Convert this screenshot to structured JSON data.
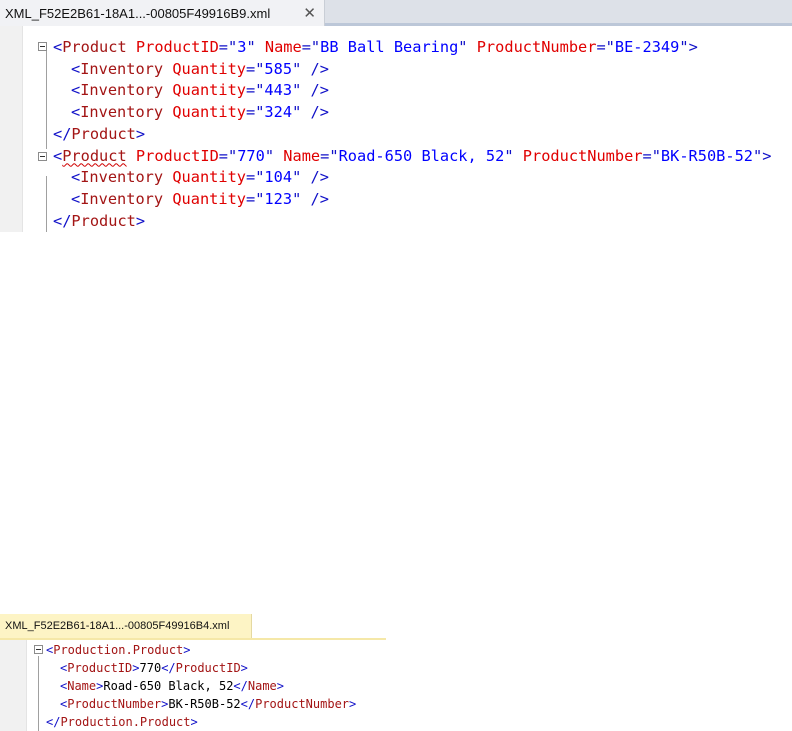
{
  "top_panel": {
    "tab_title": "XML_F52E2B61-18A1...-00805F49916B9.xml",
    "close_glyph": "✕",
    "lines": [
      {
        "indent": 0,
        "parts": [
          [
            "<",
            "br"
          ],
          [
            "Product",
            "el"
          ],
          [
            " ProductID",
            "at"
          ],
          [
            "=\"",
            "br"
          ],
          [
            "3",
            "va"
          ],
          [
            "\"",
            "br"
          ],
          [
            " Name",
            "at"
          ],
          [
            "=\"",
            "br"
          ],
          [
            "BB Ball Bearing",
            "va"
          ],
          [
            "\"",
            "br"
          ],
          [
            " ProductNumber",
            "at"
          ],
          [
            "=\"",
            "br"
          ],
          [
            "BE-2349",
            "va"
          ],
          [
            "\"",
            "br"
          ],
          [
            ">",
            "br"
          ]
        ]
      },
      {
        "indent": 1,
        "parts": [
          [
            "<",
            "br"
          ],
          [
            "Inventory",
            "el"
          ],
          [
            " Quantity",
            "at"
          ],
          [
            "=\"",
            "br"
          ],
          [
            "585",
            "va"
          ],
          [
            "\"",
            "br"
          ],
          [
            " />",
            "br"
          ]
        ]
      },
      {
        "indent": 1,
        "parts": [
          [
            "<",
            "br"
          ],
          [
            "Inventory",
            "el"
          ],
          [
            " Quantity",
            "at"
          ],
          [
            "=\"",
            "br"
          ],
          [
            "443",
            "va"
          ],
          [
            "\"",
            "br"
          ],
          [
            " />",
            "br"
          ]
        ]
      },
      {
        "indent": 1,
        "parts": [
          [
            "<",
            "br"
          ],
          [
            "Inventory",
            "el"
          ],
          [
            " Quantity",
            "at"
          ],
          [
            "=\"",
            "br"
          ],
          [
            "324",
            "va"
          ],
          [
            "\"",
            "br"
          ],
          [
            " />",
            "br"
          ]
        ]
      },
      {
        "indent": 0,
        "parts": [
          [
            "</",
            "br"
          ],
          [
            "Product",
            "el"
          ],
          [
            ">",
            "br"
          ]
        ]
      },
      {
        "indent": 0,
        "parts": [
          [
            "<",
            "br"
          ],
          [
            "Product",
            "el squiggle"
          ],
          [
            " ProductID",
            "at"
          ],
          [
            "=\"",
            "br"
          ],
          [
            "770",
            "va"
          ],
          [
            "\"",
            "br"
          ],
          [
            " Name",
            "at"
          ],
          [
            "=\"",
            "br"
          ],
          [
            "Road-650 Black, 52",
            "va"
          ],
          [
            "\"",
            "br"
          ],
          [
            " ProductNumber",
            "at"
          ],
          [
            "=\"",
            "br"
          ],
          [
            "BK-R50B-52",
            "va"
          ],
          [
            "\"",
            "br"
          ],
          [
            ">",
            "br"
          ]
        ]
      },
      {
        "indent": 1,
        "parts": [
          [
            "<",
            "br"
          ],
          [
            "Inventory",
            "el"
          ],
          [
            " Quantity",
            "at"
          ],
          [
            "=\"",
            "br"
          ],
          [
            "104",
            "va"
          ],
          [
            "\"",
            "br"
          ],
          [
            " />",
            "br"
          ]
        ]
      },
      {
        "indent": 1,
        "parts": [
          [
            "<",
            "br"
          ],
          [
            "Inventory",
            "el"
          ],
          [
            " Quantity",
            "at"
          ],
          [
            "=\"",
            "br"
          ],
          [
            "123",
            "va"
          ],
          [
            "\"",
            "br"
          ],
          [
            " />",
            "br"
          ]
        ]
      },
      {
        "indent": 0,
        "parts": [
          [
            "</",
            "br"
          ],
          [
            "Product",
            "el"
          ],
          [
            ">",
            "br"
          ]
        ]
      }
    ]
  },
  "bottom_panel": {
    "tab_title": "XML_F52E2B61-18A1...-00805F49916B4.xml",
    "lines": [
      {
        "indent": 0,
        "parts": [
          [
            "<",
            "br"
          ],
          [
            "Production.Product",
            "el"
          ],
          [
            ">",
            "br"
          ]
        ]
      },
      {
        "indent": 1,
        "parts": [
          [
            "<",
            "br"
          ],
          [
            "ProductID",
            "el"
          ],
          [
            ">",
            "br"
          ],
          [
            "770",
            "tx"
          ],
          [
            "</",
            "br"
          ],
          [
            "ProductID",
            "el"
          ],
          [
            ">",
            "br"
          ]
        ]
      },
      {
        "indent": 1,
        "parts": [
          [
            "<",
            "br"
          ],
          [
            "Name",
            "el"
          ],
          [
            ">",
            "br"
          ],
          [
            "Road-650 Black, 52",
            "tx"
          ],
          [
            "</",
            "br"
          ],
          [
            "Name",
            "el"
          ],
          [
            ">",
            "br"
          ]
        ]
      },
      {
        "indent": 1,
        "parts": [
          [
            "<",
            "br"
          ],
          [
            "ProductNumber",
            "el"
          ],
          [
            ">",
            "br"
          ],
          [
            "BK-R50B-52",
            "tx"
          ],
          [
            "</",
            "br"
          ],
          [
            "ProductNumber",
            "el"
          ],
          [
            ">",
            "br"
          ]
        ]
      },
      {
        "indent": 0,
        "parts": [
          [
            "</",
            "br"
          ],
          [
            "Production.Product",
            "el"
          ],
          [
            ">",
            "br"
          ]
        ]
      }
    ]
  },
  "colors": {
    "bracket": "#1010c8",
    "element": "#a31515",
    "attribute": "#e00000",
    "value": "#0000ff"
  }
}
